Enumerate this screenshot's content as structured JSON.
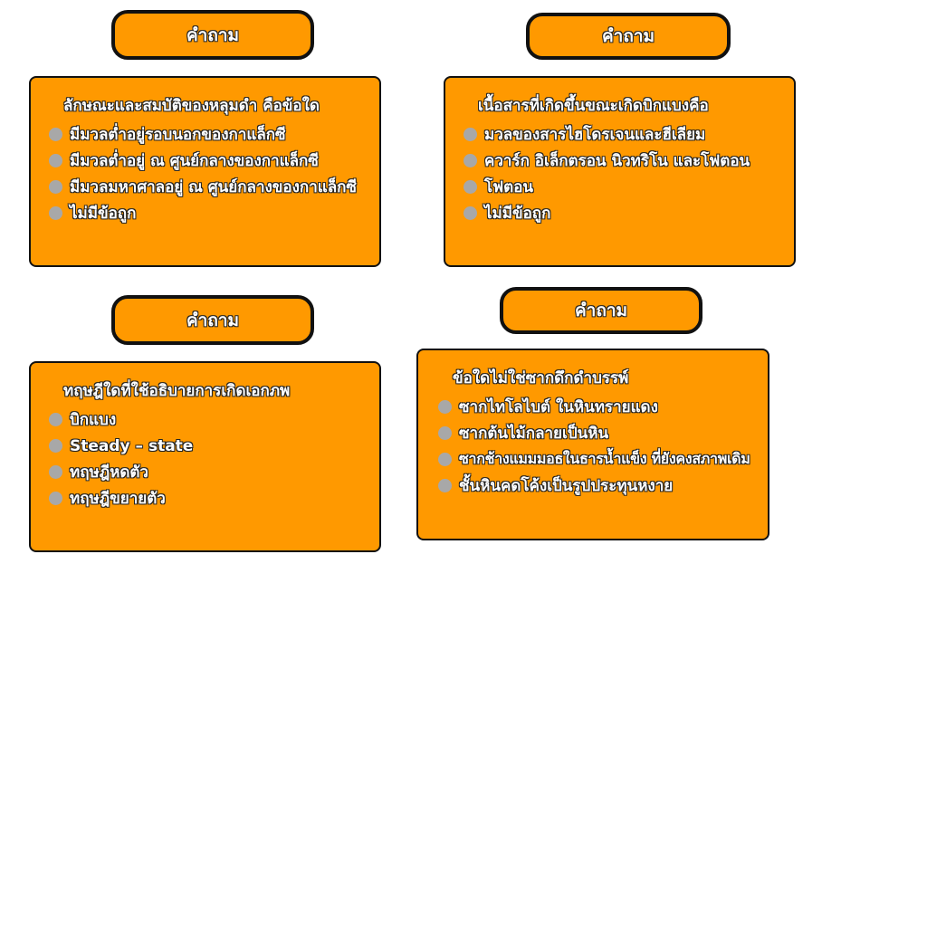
{
  "quizzes": [
    {
      "title": "คำถาม",
      "question": "ลักษณะและสมบัติของหลุมดำ คือข้อใด",
      "options": [
        "มีมวลต่ำอยู่รอบนอกของกาแล็กซี",
        "มีมวลต่ำอยู่ ณ ศูนย์กลางของกาแล็กซี",
        "มีมวลมหาศาลอยู่ ณ ศูนย์กลางของกาแล็กซี",
        "ไม่มีข้อถูก"
      ]
    },
    {
      "title": "คำถาม",
      "question": "เนื้อสารที่เกิดขึ้นขณะเกิดบิกแบงคือ",
      "options": [
        "มวลของสารไฮโดรเจนและฮีเลียม",
        "ควาร์ก อิเล็กตรอน นิวทริโน และโฟตอน",
        "โฟตอน",
        "ไม่มีข้อถูก"
      ]
    },
    {
      "title": "คำถาม",
      "question": "ทฤษฎีใดที่ใช้อธิบายการเกิดเอกภพ",
      "options": [
        "บิกแบง",
        "Steady – state",
        "ทฤษฎีหดตัว",
        "ทฤษฎีขยายตัว"
      ]
    },
    {
      "title": "คำถาม",
      "question": "ข้อใดไม่ใช่ซากดึกดำบรรพ์",
      "options": [
        "ซากไทโลไบต์ ในหินทรายแดง",
        "ซากต้นไม้กลายเป็นหิน",
        "ซากช้างแมมมอธในธารน้ำแข็ง ที่ยังคงสภาพเดิม",
        "ชั้นหินคดโค้งเป็นรูปประทุนหงาย"
      ]
    }
  ],
  "colors": {
    "card_fill": "#ff9900",
    "border": "#111111",
    "radio": "#a8a8a8",
    "text": "#ffffff"
  }
}
